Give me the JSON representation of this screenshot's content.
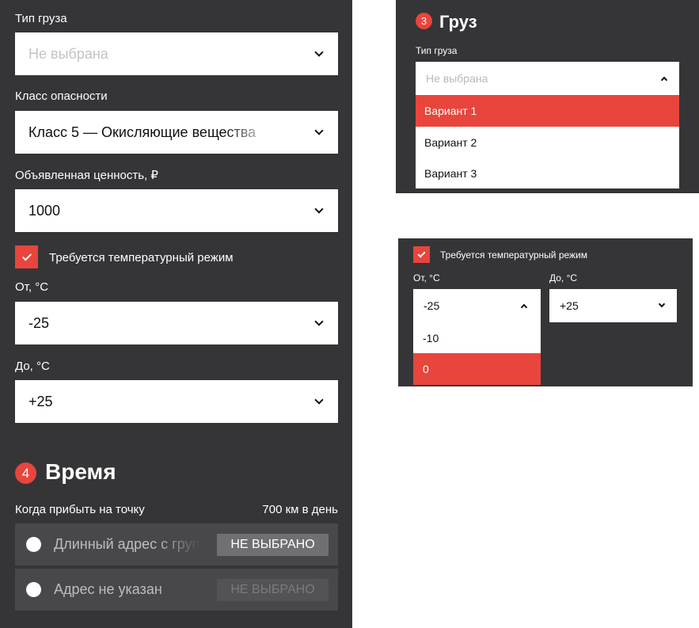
{
  "colors": {
    "panel_bg": "#353538",
    "accent": "#e8453c",
    "field_bg": "#ffffff",
    "row_bg": "#48484b"
  },
  "main": {
    "cargo_type": {
      "label": "Тип груза",
      "value": "Не выбрана"
    },
    "hazard_class": {
      "label": "Класс опасности",
      "value": "Класс 5 — Окисляющие вещества"
    },
    "declared_value": {
      "label": "Объявленная ценность, ₽",
      "value": "1000"
    },
    "temperature": {
      "checkbox_label": "Требуется температурный режим",
      "checked": true
    },
    "temp_from": {
      "label": "От, °С",
      "value": "-25"
    },
    "temp_to": {
      "label": "До, °С",
      "value": "+25"
    },
    "time_section": {
      "number": "4",
      "title": "Время"
    },
    "arrival": {
      "label": "Когда прибыть на точку",
      "distance": "700 км в день"
    },
    "points": [
      {
        "address": "Длинный адрес с группой",
        "button": "НЕ ВЫБРАНО",
        "enabled": true
      },
      {
        "address": "Адрес не указан",
        "button": "НЕ ВЫБРАНО",
        "enabled": false
      }
    ]
  },
  "cargo_panel": {
    "number": "3",
    "title": "Груз",
    "type_label": "Тип груза",
    "placeholder": "Не выбрана",
    "options": [
      "Вариант 1",
      "Вариант 2",
      "Вариант 3"
    ],
    "highlighted_index": 0
  },
  "temp_panel": {
    "checkbox_label": "Требуется температурный режим",
    "checked": true,
    "from": {
      "label": "От, °С",
      "value": "-25",
      "options": [
        "-10",
        "0"
      ],
      "highlighted": "0"
    },
    "to": {
      "label": "До, °С",
      "value": "+25"
    }
  }
}
